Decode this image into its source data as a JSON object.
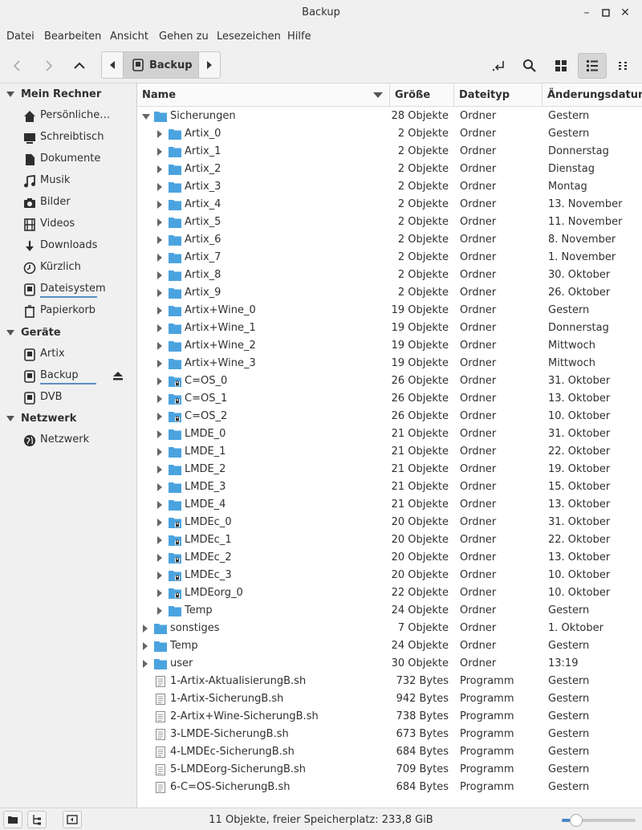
{
  "window": {
    "title": "Backup"
  },
  "menu": [
    "Datei",
    "Bearbeiten",
    "Ansicht",
    "Gehen zu",
    "Lesezeichen",
    "Hilfe"
  ],
  "pathbar": {
    "current": "Backup"
  },
  "sidebar": {
    "sections": [
      {
        "title": "Mein Rechner",
        "items": [
          {
            "label": "Persönliche…",
            "icon": "home-icon"
          },
          {
            "label": "Schreibtisch",
            "icon": "desktop-icon"
          },
          {
            "label": "Dokumente",
            "icon": "document-icon"
          },
          {
            "label": "Musik",
            "icon": "music-icon"
          },
          {
            "label": "Bilder",
            "icon": "camera-icon"
          },
          {
            "label": "Videos",
            "icon": "film-icon"
          },
          {
            "label": "Downloads",
            "icon": "download-icon"
          },
          {
            "label": "Kürzlich",
            "icon": "clock-icon"
          },
          {
            "label": "Dateisystem",
            "icon": "drive-icon",
            "usage": 0.67
          },
          {
            "label": "Papierkorb",
            "icon": "trash-icon"
          }
        ]
      },
      {
        "title": "Geräte",
        "items": [
          {
            "label": "Artix",
            "icon": "drive-icon"
          },
          {
            "label": "Backup",
            "icon": "drive-icon",
            "usage": 0.63,
            "eject": true
          },
          {
            "label": "DVB",
            "icon": "drive-icon"
          }
        ]
      },
      {
        "title": "Netzwerk",
        "items": [
          {
            "label": "Netzwerk",
            "icon": "network-icon"
          }
        ]
      }
    ]
  },
  "columns": {
    "name": "Name",
    "size": "Größe",
    "type": "Dateityp",
    "date": "Änderungsdatum"
  },
  "rows": [
    {
      "name": "Sicherungen",
      "size": "28 Objekte",
      "type": "Ordner",
      "date": "Gestern",
      "level": 0,
      "kind": "folder",
      "expanded": true
    },
    {
      "name": "Artix_0",
      "size": "2 Objekte",
      "type": "Ordner",
      "date": "Gestern",
      "level": 1,
      "kind": "folder"
    },
    {
      "name": "Artix_1",
      "size": "2 Objekte",
      "type": "Ordner",
      "date": "Donnerstag",
      "level": 1,
      "kind": "folder"
    },
    {
      "name": "Artix_2",
      "size": "2 Objekte",
      "type": "Ordner",
      "date": "Dienstag",
      "level": 1,
      "kind": "folder"
    },
    {
      "name": "Artix_3",
      "size": "2 Objekte",
      "type": "Ordner",
      "date": "Montag",
      "level": 1,
      "kind": "folder"
    },
    {
      "name": "Artix_4",
      "size": "2 Objekte",
      "type": "Ordner",
      "date": "13. November",
      "level": 1,
      "kind": "folder"
    },
    {
      "name": "Artix_5",
      "size": "2 Objekte",
      "type": "Ordner",
      "date": "11. November",
      "level": 1,
      "kind": "folder"
    },
    {
      "name": "Artix_6",
      "size": "2 Objekte",
      "type": "Ordner",
      "date": "8. November",
      "level": 1,
      "kind": "folder"
    },
    {
      "name": "Artix_7",
      "size": "2 Objekte",
      "type": "Ordner",
      "date": "1. November",
      "level": 1,
      "kind": "folder"
    },
    {
      "name": "Artix_8",
      "size": "2 Objekte",
      "type": "Ordner",
      "date": "30. Oktober",
      "level": 1,
      "kind": "folder"
    },
    {
      "name": "Artix_9",
      "size": "2 Objekte",
      "type": "Ordner",
      "date": "26. Oktober",
      "level": 1,
      "kind": "folder"
    },
    {
      "name": "Artix+Wine_0",
      "size": "19 Objekte",
      "type": "Ordner",
      "date": "Gestern",
      "level": 1,
      "kind": "folder"
    },
    {
      "name": "Artix+Wine_1",
      "size": "19 Objekte",
      "type": "Ordner",
      "date": "Donnerstag",
      "level": 1,
      "kind": "folder"
    },
    {
      "name": "Artix+Wine_2",
      "size": "19 Objekte",
      "type": "Ordner",
      "date": "Mittwoch",
      "level": 1,
      "kind": "folder"
    },
    {
      "name": "Artix+Wine_3",
      "size": "19 Objekte",
      "type": "Ordner",
      "date": "Mittwoch",
      "level": 1,
      "kind": "folder"
    },
    {
      "name": "C=OS_0",
      "size": "26 Objekte",
      "type": "Ordner",
      "date": "31. Oktober",
      "level": 1,
      "kind": "locked-folder"
    },
    {
      "name": "C=OS_1",
      "size": "26 Objekte",
      "type": "Ordner",
      "date": "13. Oktober",
      "level": 1,
      "kind": "locked-folder"
    },
    {
      "name": "C=OS_2",
      "size": "26 Objekte",
      "type": "Ordner",
      "date": "10. Oktober",
      "level": 1,
      "kind": "locked-folder"
    },
    {
      "name": "LMDE_0",
      "size": "21 Objekte",
      "type": "Ordner",
      "date": "31. Oktober",
      "level": 1,
      "kind": "folder"
    },
    {
      "name": "LMDE_1",
      "size": "21 Objekte",
      "type": "Ordner",
      "date": "22. Oktober",
      "level": 1,
      "kind": "folder"
    },
    {
      "name": "LMDE_2",
      "size": "21 Objekte",
      "type": "Ordner",
      "date": "19. Oktober",
      "level": 1,
      "kind": "folder"
    },
    {
      "name": "LMDE_3",
      "size": "21 Objekte",
      "type": "Ordner",
      "date": "15. Oktober",
      "level": 1,
      "kind": "folder"
    },
    {
      "name": "LMDE_4",
      "size": "21 Objekte",
      "type": "Ordner",
      "date": "13. Oktober",
      "level": 1,
      "kind": "folder"
    },
    {
      "name": "LMDEc_0",
      "size": "20 Objekte",
      "type": "Ordner",
      "date": "31. Oktober",
      "level": 1,
      "kind": "locked-folder"
    },
    {
      "name": "LMDEc_1",
      "size": "20 Objekte",
      "type": "Ordner",
      "date": "22. Oktober",
      "level": 1,
      "kind": "locked-folder"
    },
    {
      "name": "LMDEc_2",
      "size": "20 Objekte",
      "type": "Ordner",
      "date": "13. Oktober",
      "level": 1,
      "kind": "locked-folder"
    },
    {
      "name": "LMDEc_3",
      "size": "20 Objekte",
      "type": "Ordner",
      "date": "10. Oktober",
      "level": 1,
      "kind": "locked-folder"
    },
    {
      "name": "LMDEorg_0",
      "size": "22 Objekte",
      "type": "Ordner",
      "date": "10. Oktober",
      "level": 1,
      "kind": "locked-folder"
    },
    {
      "name": "Temp",
      "size": "24 Objekte",
      "type": "Ordner",
      "date": "Gestern",
      "level": 1,
      "kind": "folder"
    },
    {
      "name": "sonstiges",
      "size": "7 Objekte",
      "type": "Ordner",
      "date": "1. Oktober",
      "level": 0,
      "kind": "folder"
    },
    {
      "name": "Temp",
      "size": "24 Objekte",
      "type": "Ordner",
      "date": "Gestern",
      "level": 0,
      "kind": "folder"
    },
    {
      "name": "user",
      "size": "30 Objekte",
      "type": "Ordner",
      "date": "13:19",
      "level": 0,
      "kind": "folder"
    },
    {
      "name": "1-Artix-AktualisierungB.sh",
      "size": "732 Bytes",
      "type": "Programm",
      "date": "Gestern",
      "level": 0,
      "kind": "file"
    },
    {
      "name": "1-Artix-SicherungB.sh",
      "size": "942 Bytes",
      "type": "Programm",
      "date": "Gestern",
      "level": 0,
      "kind": "file"
    },
    {
      "name": "2-Artix+Wine-SicherungB.sh",
      "size": "738 Bytes",
      "type": "Programm",
      "date": "Gestern",
      "level": 0,
      "kind": "file"
    },
    {
      "name": "3-LMDE-SicherungB.sh",
      "size": "673 Bytes",
      "type": "Programm",
      "date": "Gestern",
      "level": 0,
      "kind": "file"
    },
    {
      "name": "4-LMDEc-SicherungB.sh",
      "size": "684 Bytes",
      "type": "Programm",
      "date": "Gestern",
      "level": 0,
      "kind": "file"
    },
    {
      "name": "5-LMDEorg-SicherungB.sh",
      "size": "709 Bytes",
      "type": "Programm",
      "date": "Gestern",
      "level": 0,
      "kind": "file"
    },
    {
      "name": "6-C=OS-SicherungB.sh",
      "size": "684 Bytes",
      "type": "Programm",
      "date": "Gestern",
      "level": 0,
      "kind": "file"
    }
  ],
  "status": {
    "text": "11 Objekte, freier Speicherplatz: 233,8 GiB",
    "zoom_level": 0.2
  },
  "colors": {
    "folder": "#4aa3df",
    "accent": "#5a8ec4",
    "selected_toolbar": "#d6d6d6"
  }
}
